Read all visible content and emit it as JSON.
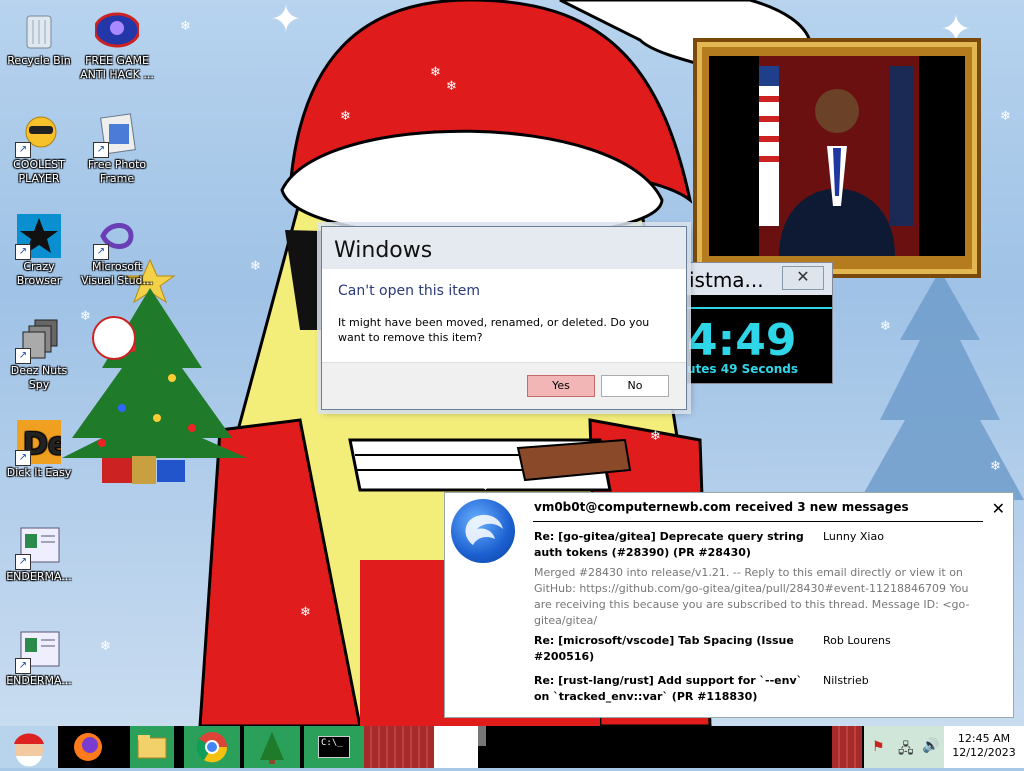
{
  "desktop": {
    "icons": [
      {
        "label": "Recycle Bin",
        "icon": "recycle-bin-icon"
      },
      {
        "label": "FREE GAME ANTI HACK ...",
        "icon": "anti-hack-icon"
      },
      {
        "label": "COOLEST PLAYER",
        "icon": "coolest-player-icon"
      },
      {
        "label": "Free Photo Frame",
        "icon": "photo-frame-icon"
      },
      {
        "label": "Crazy Browser",
        "icon": "crazy-browser-icon"
      },
      {
        "label": "Microsoft Visual Stud...",
        "icon": "visual-studio-icon"
      },
      {
        "label": "Deez Nuts Spy",
        "icon": "deez-nuts-spy-icon"
      },
      {
        "label": "Dick It Easy",
        "icon": "dick-it-easy-icon"
      },
      {
        "label": "ENDERMA...",
        "icon": "enderma-icon"
      },
      {
        "label": "ENDERMA...",
        "icon": "enderma-icon"
      }
    ]
  },
  "dialog": {
    "title": "Windows",
    "heading": "Can't open this item",
    "message": "It might have been moved, renamed, or deleted. Do you want to remove this item?",
    "yes_label": "Yes",
    "no_label": "No"
  },
  "countdown": {
    "title": "istma...",
    "close_glyph": "✕",
    "time": "4:49",
    "subtitle": "utes 49 Seconds"
  },
  "notification": {
    "header": "vm0b0t@computernewb.com received 3 new messages",
    "close_glyph": "✕",
    "messages": [
      {
        "subject": "Re: [go-gitea/gitea] Deprecate query string auth tokens (#28390) (PR #28430)",
        "from": "Lunny Xiao"
      },
      {
        "subject": "Re: [microsoft/vscode] Tab Spacing (Issue #200516)",
        "from": "Rob Lourens"
      },
      {
        "subject": "Re: [rust-lang/rust] Add support for `--env` on `tracked_env::var` (PR #118830)",
        "from": "Nilstrieb"
      }
    ],
    "preview": "Merged #28430 into release/v1.21. -- Reply to this email directly or view it on GitHub: https://github.com/go-gitea/gitea/pull/28430#event-11218846709 You are receiving this because you are subscribed to this thread. Message ID: <go-gitea/gitea/"
  },
  "taskbar": {
    "cmd_label": "C:\\_",
    "clock_time": "12:45 AM",
    "clock_date": "12/12/2023"
  },
  "colors": {
    "dialog_yes": "#f2b6b6",
    "countdown_text": "#2fd6e8",
    "santa_red": "#e11c1c"
  }
}
